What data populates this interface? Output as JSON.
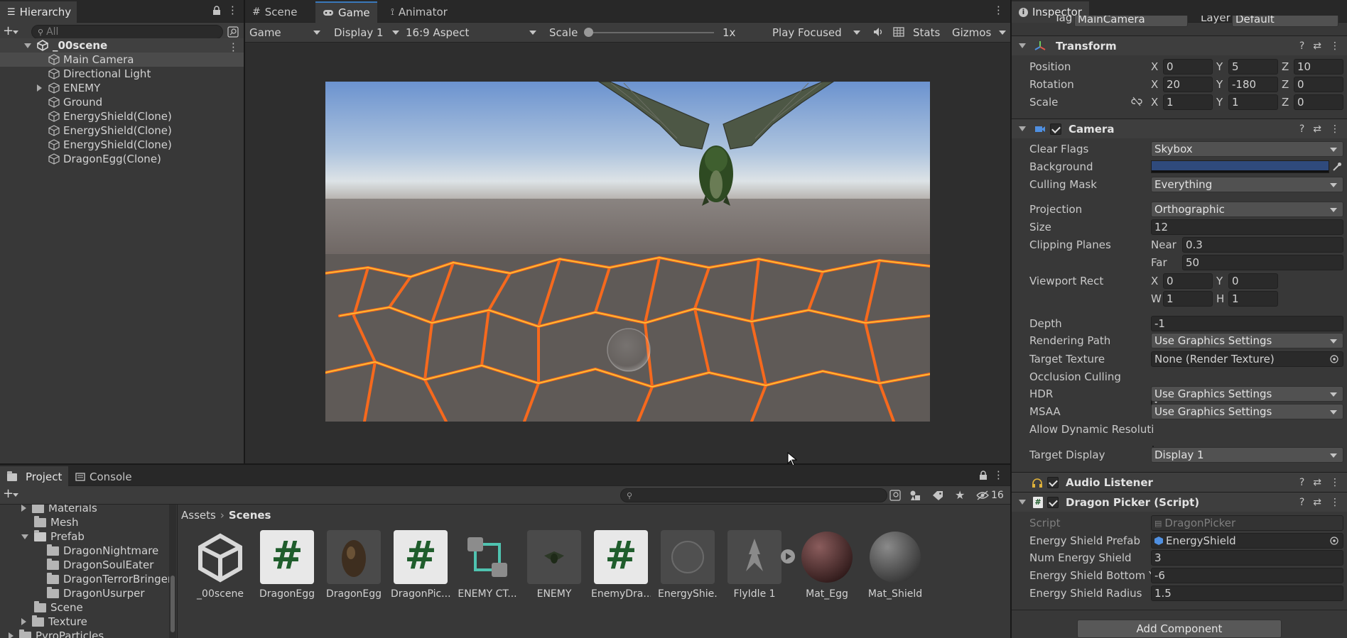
{
  "hierarchy": {
    "tab_label": "Hierarchy",
    "search_placeholder": "All",
    "scene_name": "_00scene",
    "items": [
      {
        "label": "Main Camera"
      },
      {
        "label": "Directional Light"
      },
      {
        "label": "ENEMY"
      },
      {
        "label": "Ground"
      },
      {
        "label": "EnergyShield(Clone)"
      },
      {
        "label": "EnergyShield(Clone)"
      },
      {
        "label": "EnergyShield(Clone)"
      },
      {
        "label": "DragonEgg(Clone)"
      }
    ]
  },
  "center": {
    "tabs": [
      "Scene",
      "Game",
      "Animator"
    ],
    "toolbar": {
      "mode": "Game",
      "display": "Display 1",
      "aspect": "16:9 Aspect",
      "scale_label": "Scale",
      "scale_value": "1x",
      "play_mode": "Play Focused",
      "stats": "Stats",
      "gizmos": "Gizmos"
    }
  },
  "project": {
    "tabs": [
      "Project",
      "Console"
    ],
    "hidden_count": "16",
    "breadcrumb": [
      "Assets",
      "Scenes"
    ],
    "tree": [
      {
        "label": "Materials"
      },
      {
        "label": "Mesh"
      },
      {
        "label": "Prefab"
      },
      {
        "label": "DragonNightmare"
      },
      {
        "label": "DragonSoulEater"
      },
      {
        "label": "DragonTerrorBringer"
      },
      {
        "label": "DragonUsurper"
      },
      {
        "label": "Scene"
      },
      {
        "label": "Texture"
      },
      {
        "label": "PyroParticles"
      }
    ],
    "assets": [
      {
        "label": "_00scene",
        "icon": "unity-scene-icon"
      },
      {
        "label": "DragonEgg",
        "icon": "csharp-script-icon"
      },
      {
        "label": "DragonEgg",
        "icon": "egg-prefab-icon"
      },
      {
        "label": "DragonPic...",
        "icon": "csharp-script-icon"
      },
      {
        "label": "ENEMY CT...",
        "icon": "animator-controller-icon"
      },
      {
        "label": "ENEMY",
        "icon": "dragon-prefab-icon"
      },
      {
        "label": "EnemyDra...",
        "icon": "csharp-script-icon"
      },
      {
        "label": "EnergyShie...",
        "icon": "sphere-prefab-icon"
      },
      {
        "label": "FlyIdle 1",
        "icon": "animation-clip-icon"
      },
      {
        "label": "Mat_Egg",
        "icon": "material-sphere-icon"
      },
      {
        "label": "Mat_Shield",
        "icon": "material-sphere-icon"
      }
    ]
  },
  "inspector": {
    "tab_label": "Inspector",
    "tag_label": "Tag",
    "tag_value": "MainCamera",
    "layer_label": "Layer",
    "layer_value": "Default",
    "transform": {
      "title": "Transform",
      "position_label": "Position",
      "position": [
        "0",
        "5",
        "10"
      ],
      "rotation_label": "Rotation",
      "rotation": [
        "20",
        "-180",
        "0"
      ],
      "scale_label": "Scale",
      "scale": [
        "1",
        "1",
        "0"
      ]
    },
    "camera": {
      "title": "Camera",
      "clear_flags_label": "Clear Flags",
      "clear_flags": "Skybox",
      "background_label": "Background",
      "background_color": "#2f4a7c",
      "culling_mask_label": "Culling Mask",
      "culling_mask": "Everything",
      "projection_label": "Projection",
      "projection": "Orthographic",
      "size_label": "Size",
      "size": "12",
      "clipping_label": "Clipping Planes",
      "near_label": "Near",
      "near": "0.3",
      "far_label": "Far",
      "far": "50",
      "viewport_label": "Viewport Rect",
      "viewport": {
        "x": "0",
        "y": "0",
        "w": "1",
        "h": "1"
      },
      "depth_label": "Depth",
      "depth": "-1",
      "rendering_path_label": "Rendering Path",
      "rendering_path": "Use Graphics Settings",
      "target_texture_label": "Target Texture",
      "target_texture": "None (Render Texture)",
      "occlusion_label": "Occlusion Culling",
      "hdr_label": "HDR",
      "hdr": "Use Graphics Settings",
      "msaa_label": "MSAA",
      "msaa": "Use Graphics Settings",
      "dynamic_res_label": "Allow Dynamic Resoluti",
      "target_display_label": "Target Display",
      "target_display": "Display 1"
    },
    "audio_listener": {
      "title": "Audio Listener"
    },
    "dragon_picker": {
      "title": "Dragon Picker (Script)",
      "script_label": "Script",
      "script": "DragonPicker",
      "prefab_label": "Energy Shield Prefab",
      "prefab": "EnergyShield",
      "num_label": "Num Energy Shield",
      "num": "3",
      "bottom_label": "Energy Shield Bottom Y",
      "bottom": "-6",
      "radius_label": "Energy Shield Radius",
      "radius": "1.5"
    },
    "add_component": "Add Component"
  }
}
